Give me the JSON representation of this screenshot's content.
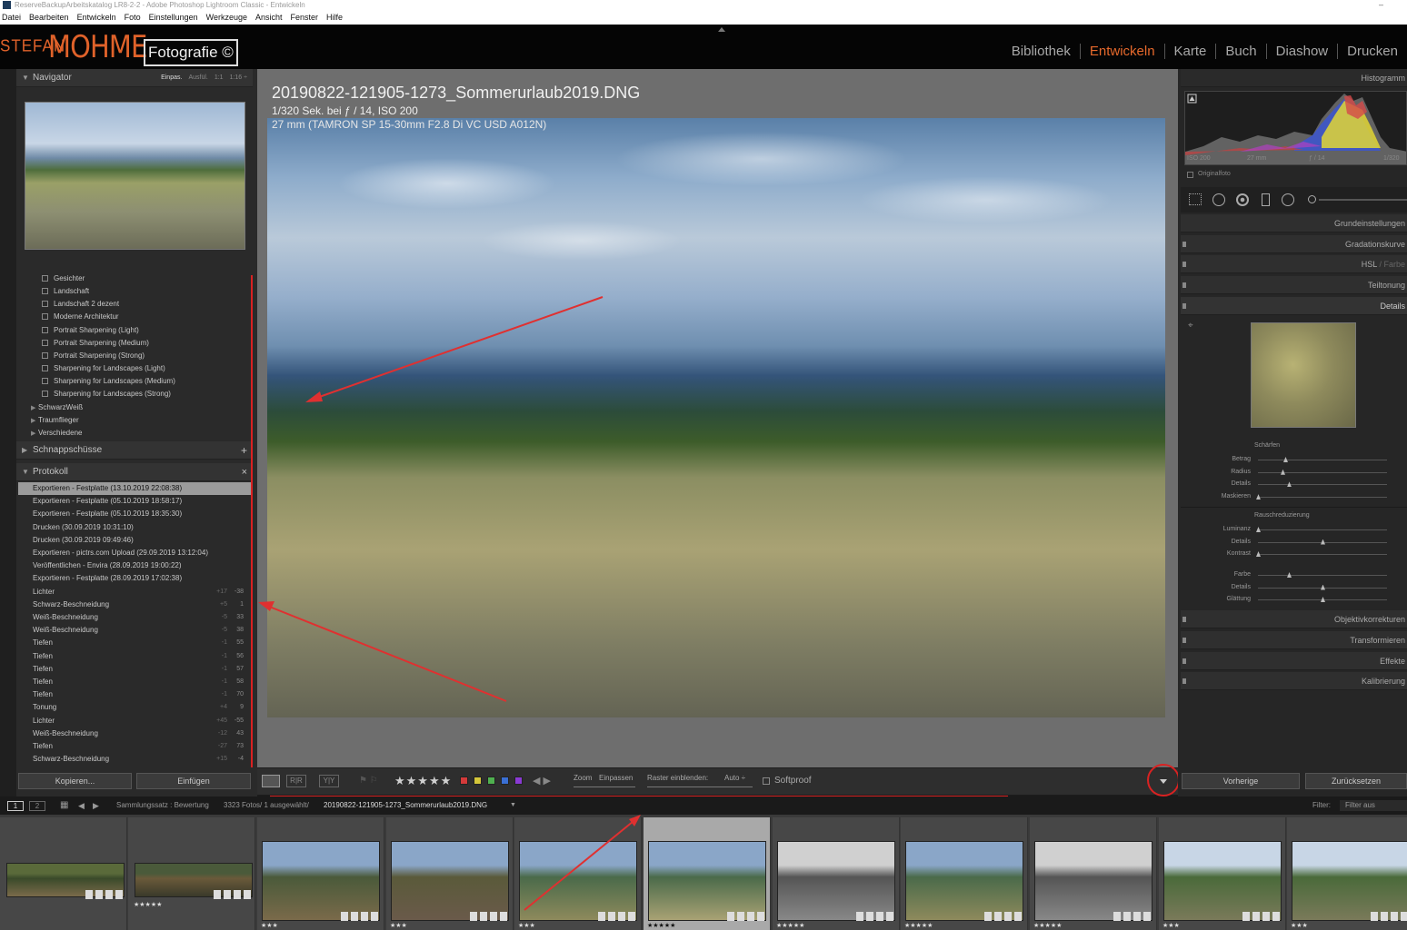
{
  "window": {
    "title": "ReserveBackupArbeitskatalog LR8-2-2 - Adobe Photoshop Lightroom Classic - Entwickeln"
  },
  "menu": [
    "Datei",
    "Bearbeiten",
    "Entwickeln",
    "Foto",
    "Einstellungen",
    "Werkzeuge",
    "Ansicht",
    "Fenster",
    "Hilfe"
  ],
  "brand": {
    "part1": "STEFAN",
    "part2": "MOHME",
    "part3": "Fotografie ©"
  },
  "modules": [
    {
      "label": "Bibliothek",
      "active": false
    },
    {
      "label": "Entwickeln",
      "active": true
    },
    {
      "label": "Karte",
      "active": false
    },
    {
      "label": "Buch",
      "active": false
    },
    {
      "label": "Diashow",
      "active": false
    },
    {
      "label": "Drucken",
      "active": false
    }
  ],
  "left": {
    "navigator_title": "Navigator",
    "nav_zoom": [
      "Einpas.",
      "Ausfül.",
      "1:1",
      "1:16 ÷"
    ],
    "presets": [
      "Gesichter",
      "Landschaft",
      "Landschaft 2 dezent",
      "Moderne Architektur",
      "Portrait Sharpening (Light)",
      "Portrait Sharpening (Medium)",
      "Portrait Sharpening (Strong)",
      "Sharpening for Landscapes (Light)",
      "Sharpening for Landscapes (Medium)",
      "Sharpening for Landscapes (Strong)"
    ],
    "folders": [
      "SchwarzWeiß",
      "Traumflieger",
      "Verschiedene"
    ],
    "snapshots_title": "Schnappschüsse",
    "snapshots_action": "+",
    "history_title": "Protokoll",
    "history_action": "×",
    "history": [
      {
        "label": "Exportieren - Festplatte (13.10.2019 22:08:38)",
        "v1": "",
        "v2": ""
      },
      {
        "label": "Exportieren - Festplatte (05.10.2019 18:58:17)",
        "v1": "",
        "v2": ""
      },
      {
        "label": "Exportieren - Festplatte (05.10.2019 18:35:30)",
        "v1": "",
        "v2": ""
      },
      {
        "label": "Drucken (30.09.2019 10:31:10)",
        "v1": "",
        "v2": ""
      },
      {
        "label": "Drucken (30.09.2019 09:49:46)",
        "v1": "",
        "v2": ""
      },
      {
        "label": "Exportieren - pictrs.com Upload (29.09.2019 13:12:04)",
        "v1": "",
        "v2": ""
      },
      {
        "label": "Veröffentlichen - Envira (28.09.2019 19:00:22)",
        "v1": "",
        "v2": ""
      },
      {
        "label": "Exportieren - Festplatte (28.09.2019 17:02:38)",
        "v1": "",
        "v2": ""
      },
      {
        "label": "Lichter",
        "v1": "+17",
        "v2": "-38"
      },
      {
        "label": "Schwarz-Beschneidung",
        "v1": "+5",
        "v2": "1"
      },
      {
        "label": "Weiß-Beschneidung",
        "v1": "-5",
        "v2": "33"
      },
      {
        "label": "Weiß-Beschneidung",
        "v1": "-5",
        "v2": "38"
      },
      {
        "label": "Tiefen",
        "v1": "-1",
        "v2": "55"
      },
      {
        "label": "Tiefen",
        "v1": "-1",
        "v2": "56"
      },
      {
        "label": "Tiefen",
        "v1": "-1",
        "v2": "57"
      },
      {
        "label": "Tiefen",
        "v1": "-1",
        "v2": "58"
      },
      {
        "label": "Tiefen",
        "v1": "-1",
        "v2": "70"
      },
      {
        "label": "Tonung",
        "v1": "+4",
        "v2": "9"
      },
      {
        "label": "Lichter",
        "v1": "+45",
        "v2": "-55"
      },
      {
        "label": "Weiß-Beschneidung",
        "v1": "-12",
        "v2": "43"
      },
      {
        "label": "Tiefen",
        "v1": "-27",
        "v2": "73"
      },
      {
        "label": "Schwarz-Beschneidung",
        "v1": "+15",
        "v2": "-4"
      }
    ],
    "copy_button": "Kopieren...",
    "paste_button": "Einfügen"
  },
  "image": {
    "filename": "20190822-121905-1273_Sommerurlaub2019.DNG",
    "exposure": "1/320 Sek. bei ƒ / 14, ISO 200",
    "lens": "27 mm (TAMRON SP 15-30mm F2.8 Di VC USD A012N)"
  },
  "toolbar": {
    "stars": "★★★★★",
    "zoom_label": "Zoom",
    "zoom_value": "Einpassen",
    "raster_label": "Raster einblenden:",
    "raster_value": "Auto ÷",
    "softproof": "Softproof",
    "colors": [
      "#d43a3a",
      "#d4c63a",
      "#4fb04f",
      "#3a6fd4",
      "#8a3ad4"
    ]
  },
  "right": {
    "histogram_title": "Histogramm",
    "hist_iso": "ISO 200",
    "hist_focal": "27 mm",
    "hist_aperture": "ƒ / 14",
    "hist_shutter": "1/320",
    "original_photo": "Originalfoto",
    "sections": [
      "Grundeinstellungen",
      "Gradationskurve",
      "HSL",
      "Farbe",
      "Teiltonung",
      "Details",
      "Objektivkorrekturen",
      "Transformieren",
      "Effekte",
      "Kalibrierung"
    ],
    "sharpen_title": "Schärfen",
    "sharpen_sliders": [
      {
        "label": "Betrag",
        "value": 0.21
      },
      {
        "label": "Radius",
        "value": 0.19
      },
      {
        "label": "Details",
        "value": 0.24
      },
      {
        "label": "Maskieren",
        "value": 0.0
      }
    ],
    "noise_title": "Rauschreduzierung",
    "noise_sliders": [
      {
        "label": "Luminanz",
        "value": 0.0
      },
      {
        "label": "Details",
        "value": 0.5
      },
      {
        "label": "Kontrast",
        "value": 0.0
      }
    ],
    "color_sliders": [
      {
        "label": "Farbe",
        "value": 0.24
      },
      {
        "label": "Details",
        "value": 0.5
      },
      {
        "label": "Glättung",
        "value": 0.5
      }
    ],
    "prev_button": "Vorherige",
    "reset_button": "Zurücksetzen"
  },
  "filmbar": {
    "page1": "1",
    "page2": "2",
    "source": "Sammlungssatz : Bewertung",
    "count": "3323 Fotos/ 1 ausgewählt/",
    "selected_file": "20190822-121905-1273_Sommerurlaub2019.DNG",
    "filter_label": "Filter:",
    "filter_value": "Filter aus"
  },
  "filmstrip": [
    {
      "stars": "",
      "selected": false,
      "colors": [
        "#5a6a3a",
        "#3a4a2a",
        "#7a6a4a"
      ]
    },
    {
      "stars": "★★★★★",
      "selected": false,
      "colors": [
        "#4a5a3a",
        "#6a5a3a",
        "#3a3a2a"
      ]
    },
    {
      "stars": "★★★",
      "selected": false,
      "colors": [
        "#8aa6c8",
        "#4a5a3a",
        "#7a6a4a"
      ]
    },
    {
      "stars": "★★★",
      "selected": false,
      "colors": [
        "#8aa6c8",
        "#5a5a3a",
        "#6a5a4a"
      ]
    },
    {
      "stars": "★★★",
      "selected": false,
      "colors": [
        "#8aa6c8",
        "#4a6a4a",
        "#8e8a5c"
      ]
    },
    {
      "stars": "★★★★★",
      "selected": true,
      "colors": [
        "#8aa6c8",
        "#4a6a4a",
        "#a9a274"
      ]
    },
    {
      "stars": "★★★★★",
      "selected": false,
      "colors": [
        "#d0d0d0",
        "#555555",
        "#888888"
      ]
    },
    {
      "stars": "★★★★★",
      "selected": false,
      "colors": [
        "#8aa6c8",
        "#4a6a4a",
        "#8e8a5c"
      ]
    },
    {
      "stars": "★★★★★",
      "selected": false,
      "colors": [
        "#d0d0d0",
        "#555555",
        "#888888"
      ]
    },
    {
      "stars": "★★★",
      "selected": false,
      "colors": [
        "#c8d6e6",
        "#4a6a3a",
        "#7a7a5a"
      ]
    },
    {
      "stars": "★★★",
      "selected": false,
      "colors": [
        "#c8d6e6",
        "#4a6a3a",
        "#7a7a5a"
      ]
    }
  ]
}
